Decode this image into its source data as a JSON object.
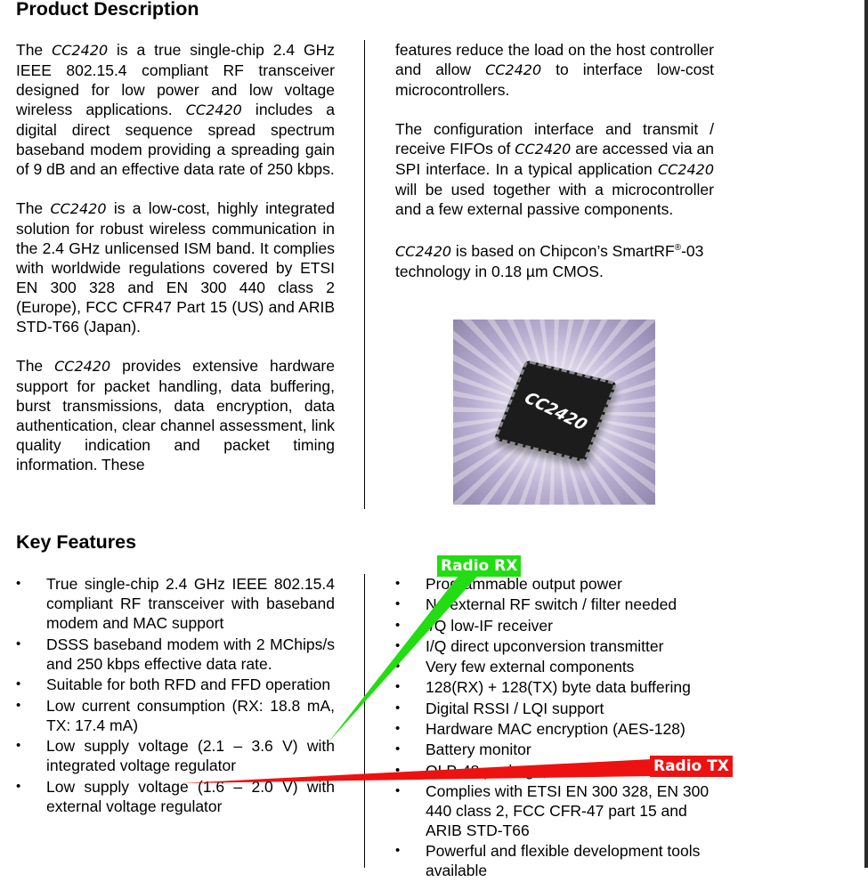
{
  "section_title": "Product Description",
  "intro_left": {
    "p1": [
      "The ",
      "CC2420",
      " is a true single-chip 2.4 GHz IEEE 802.15.4 compliant RF transceiver designed for low power and low voltage wireless applications. ",
      "CC2420",
      " includes a digital direct sequence spread spectrum baseband modem providing a spreading gain of 9 dB and an effective data rate of 250 kbps."
    ],
    "p2": [
      "The ",
      "CC2420",
      " is a low-cost, highly integrated solution for robust wireless communication in the 2.4 GHz unlicensed ISM band. It complies with worldwide regulations covered by ETSI EN 300 328 and EN 300 440 class 2 (Europe), FCC CFR47 Part 15 (US) and ARIB STD-T66 (Japan)."
    ],
    "p3": [
      "The ",
      "CC2420",
      " provides extensive hardware support for packet handling, data buffering, burst transmissions, data encryption, data authentication, clear channel assessment, link quality indication and packet timing information. These"
    ]
  },
  "intro_right": {
    "p1": [
      "features reduce the load on the host controller and allow ",
      "CC2420",
      " to interface low-cost microcontrollers."
    ],
    "p2": [
      "The configuration interface and transmit / receive FIFOs of ",
      "CC2420",
      " are accessed via an SPI interface. In a typical application ",
      "CC2420",
      " will be used together with a microcontroller and a few external passive components."
    ],
    "p3": [
      "CC2420",
      " is based on Chipcon’s SmartRF",
      "®",
      "-03 technology in 0.18 ",
      "µ",
      "m CMOS."
    ]
  },
  "chip_photo_label": "CC2420",
  "key_features_title": "Key Features",
  "bullet_glyph": "•",
  "features_left": [
    "True single-chip 2.4 GHz IEEE 802.15.4 compliant RF transceiver with baseband modem and MAC support",
    "DSSS baseband modem with 2 MChips/s and 250 kbps effective data rate.",
    "Suitable for both RFD and FFD operation",
    "Low current consumption (RX: 18.8 mA, TX: 17.4 mA)",
    "Low supply voltage (2.1 – 3.6 V) with integrated voltage regulator",
    "Low supply voltage (1.6 – 2.0 V) with external voltage regulator"
  ],
  "features_right": [
    "Programmable output power",
    "No external RF switch / filter needed",
    "I/Q low-IF receiver",
    "I/Q direct upconversion transmitter",
    "Very few external components",
    "128(RX) + 128(TX) byte data buffering",
    "Digital RSSI / LQI support",
    "Hardware MAC encryption (AES-128)",
    "Battery monitor",
    "QLP-48 package, 7x7 mm",
    "Complies with ETSI EN 300 328, EN 300 440 class 2, FCC CFR-47 part 15 and ARIB STD-T66",
    "Powerful and flexible development tools available"
  ],
  "annotations": {
    "rx": {
      "label": "Radio RX",
      "color": "#22dd11"
    },
    "tx": {
      "label": "Radio TX",
      "color": "#ee1111"
    }
  }
}
